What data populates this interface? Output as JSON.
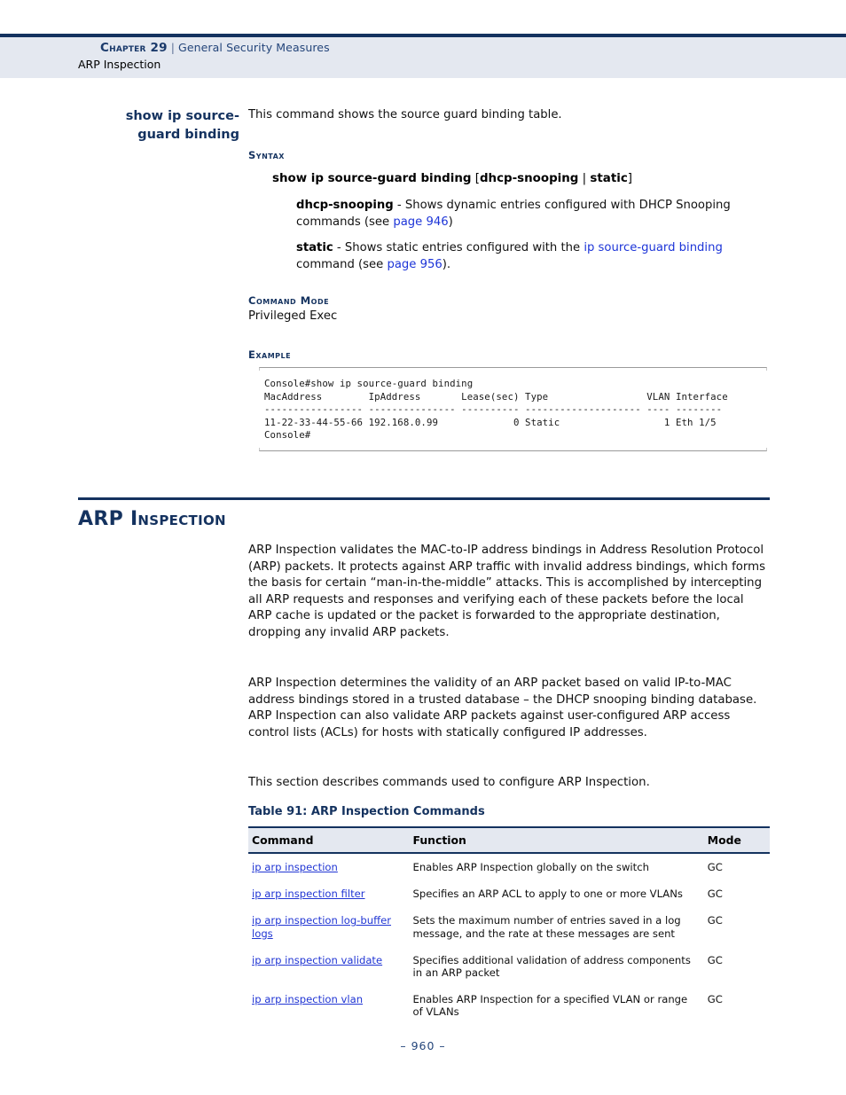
{
  "page": {
    "footer": "–  960  –",
    "accent_navy": "#14325f",
    "link_blue": "#2136d4",
    "band_gray": "#e4e8f0"
  },
  "header": {
    "chapter_word": "Chapter 29",
    "separator": "|",
    "chapter_title": "General Security Measures",
    "section": "ARP Inspection"
  },
  "command_entry": {
    "title_line1": "show ip source-",
    "title_line2": "guard binding",
    "intro": "This command shows the source guard binding table.",
    "labels": {
      "syntax": "Syntax",
      "command_mode": "Command Mode",
      "example": "Example"
    },
    "syntax": {
      "command": "show ip source-guard binding",
      "bracket_open": "[",
      "option_a": "dhcp-snooping",
      "pipe": "|",
      "option_b": "static",
      "bracket_close": "]"
    },
    "parameters": [
      {
        "name": "dhcp-snooping",
        "text_before": " - Shows dynamic entries configured with DHCP Snooping commands (see ",
        "link": "page 946",
        "text_after": ")"
      },
      {
        "name": "static",
        "text_before": " - Shows static entries configured with the ",
        "link_cmd": "ip source-guard binding",
        "text_mid": " command (see ",
        "link": "page 956",
        "text_after": ")."
      }
    ],
    "command_mode_value": "Privileged Exec",
    "console_example": "Console#show ip source-guard binding\nMacAddress        IpAddress       Lease(sec) Type                 VLAN Interface\n----------------- --------------- ---------- -------------------- ---- --------\n11-22-33-44-55-66 192.168.0.99             0 Static                  1 Eth 1/5\nConsole#"
  },
  "section": {
    "heading": "ARP Inspection",
    "paragraphs": [
      "ARP Inspection validates the MAC-to-IP address bindings in Address Resolution Protocol (ARP) packets. It protects against ARP traffic with invalid address bindings, which forms the basis for certain “man-in-the-middle” attacks. This is accomplished by intercepting all ARP requests and responses and verifying each of these packets before the local ARP cache is updated or the packet is forwarded to the appropriate destination, dropping any invalid ARP packets.",
      "ARP Inspection determines the validity of an ARP packet based on valid IP-to-MAC address bindings stored in a trusted database – the DHCP snooping binding database. ARP Inspection can also validate ARP packets against user-configured ARP access control lists (ACLs) for hosts with statically configured IP addresses.",
      "This section describes commands used to configure ARP Inspection."
    ]
  },
  "table": {
    "caption": "Table 91: ARP Inspection Commands",
    "columns": [
      "Command",
      "Function",
      "Mode"
    ],
    "rows": [
      {
        "command": "ip arp inspection",
        "function": "Enables ARP Inspection globally on the switch",
        "mode": "GC"
      },
      {
        "command": "ip arp inspection filter",
        "function": "Specifies an ARP ACL to apply to one or more VLANs",
        "mode": "GC"
      },
      {
        "command": "ip arp inspection log-buffer logs",
        "function": "Sets the maximum number of entries saved in a log message, and the rate at these messages are sent",
        "mode": "GC"
      },
      {
        "command": "ip arp inspection validate",
        "function": "Specifies additional validation of address components in an ARP packet",
        "mode": "GC"
      },
      {
        "command": "ip arp inspection vlan",
        "function": "Enables ARP Inspection for a specified VLAN or range of VLANs",
        "mode": "GC"
      }
    ]
  }
}
